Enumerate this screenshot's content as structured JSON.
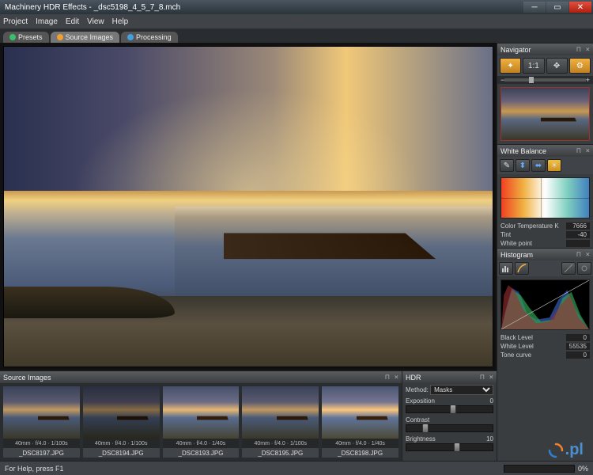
{
  "window": {
    "title": "Machinery HDR Effects - _dsc5198_4_5_7_8.mch"
  },
  "menu": [
    "Project",
    "Image",
    "Edit",
    "View",
    "Help"
  ],
  "tabs": [
    {
      "label": "Presets",
      "active": false
    },
    {
      "label": "Source Images",
      "active": true
    },
    {
      "label": "Processing",
      "active": false
    }
  ],
  "panels": {
    "sourceImages": "Source Images",
    "hdr": "HDR",
    "navigator": "Navigator",
    "whiteBalance": "White Balance",
    "histogram": "Histogram"
  },
  "source_thumbs": [
    {
      "info": "40mm · f/4.0 · 1/100s",
      "name": "_DSC8197.JPG"
    },
    {
      "info": "40mm · f/4.0 · 1/100s",
      "name": "_DSC8194.JPG"
    },
    {
      "info": "40mm · f/4.0 · 1/40s",
      "name": "_DSC8193.JPG"
    },
    {
      "info": "40mm · f/4.0 · 1/100s",
      "name": "_DSC8195.JPG"
    },
    {
      "info": "40mm · f/4.0 · 1/40s",
      "name": "_DSC8198.JPG"
    }
  ],
  "hdr": {
    "method_label": "Method:",
    "method_value": "Masks",
    "exposition": {
      "label": "Exposition",
      "value": "0",
      "pos": 50
    },
    "contrast": {
      "label": "Contrast",
      "value": "",
      "pos": 20
    },
    "brightness": {
      "label": "Brightness",
      "value": "10",
      "pos": 55
    }
  },
  "navigator": {
    "ratio": "1:1"
  },
  "white_balance": {
    "colortemp": {
      "label": "Color Temperature K",
      "value": "7666"
    },
    "tint": {
      "label": "Tint",
      "value": "-40"
    },
    "whitepoint": {
      "label": "White point",
      "value": ""
    }
  },
  "histogram": {
    "black": {
      "label": "Black Level",
      "value": "0"
    },
    "white": {
      "label": "White Level",
      "value": "55535"
    },
    "tone": {
      "label": "Tone curve",
      "value": "0"
    }
  },
  "status": {
    "help": "For Help, press F1",
    "progress_pct": "0%"
  },
  "logo_suffix": ".pl"
}
